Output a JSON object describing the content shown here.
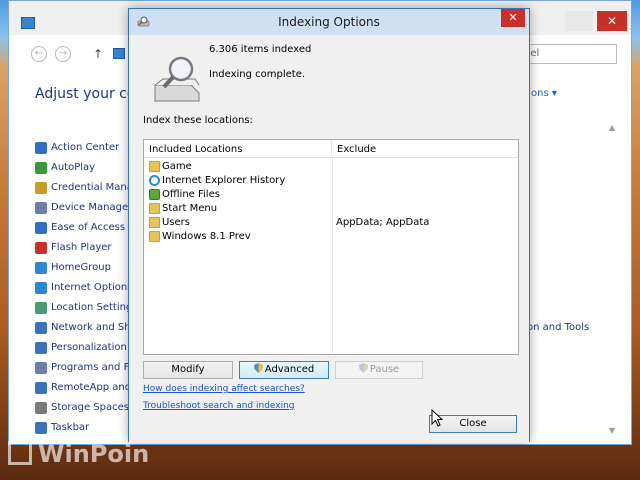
{
  "control_panel": {
    "search_placeholder": "nel",
    "heading": "Adjust your comp",
    "view_by": "ons ▾",
    "items": [
      {
        "label": "Action Center",
        "color": "#2f6fc4"
      },
      {
        "label": "AutoPlay",
        "color": "#3a9a3a"
      },
      {
        "label": "Credential Manag",
        "color": "#c79a2a"
      },
      {
        "label": "Device Manager",
        "color": "#6b7fa8"
      },
      {
        "label": "Ease of Access Ce",
        "color": "#2f6fc4"
      },
      {
        "label": "Flash Player",
        "color": "#c7312b"
      },
      {
        "label": "HomeGroup",
        "color": "#2f87d4"
      },
      {
        "label": "Internet Options",
        "color": "#2f87d4"
      },
      {
        "label": "Location Settings",
        "color": "#4a9a7a"
      },
      {
        "label": "Network and Shari",
        "color": "#3a73b8"
      },
      {
        "label": "Personalization",
        "color": "#3a73b8"
      },
      {
        "label": "Programs and Feat",
        "color": "#6b7fa8"
      },
      {
        "label": "RemoteApp and D",
        "color": "#3a73b8"
      },
      {
        "label": "Storage Spaces",
        "color": "#7a7a7a"
      },
      {
        "label": "Taskbar",
        "color": "#3a73b8"
      }
    ],
    "right_item": "on and Tools"
  },
  "dialog": {
    "title": "Indexing Options",
    "items_count": "6.306 items indexed",
    "status": "Indexing complete.",
    "caption": "Index these locations:",
    "columns": {
      "included": "Included Locations",
      "exclude": "Exclude"
    },
    "locations": [
      {
        "name": "Game",
        "exclude": "",
        "icon": "folder-icon"
      },
      {
        "name": "Internet Explorer History",
        "exclude": "",
        "icon": "internet-explorer-icon"
      },
      {
        "name": "Offline Files",
        "exclude": "",
        "icon": "offline-files-icon"
      },
      {
        "name": "Start Menu",
        "exclude": "",
        "icon": "folder-icon"
      },
      {
        "name": "Users",
        "exclude": "AppData; AppData",
        "icon": "folder-icon"
      },
      {
        "name": "Windows 8.1 Prev",
        "exclude": "",
        "icon": "folder-icon"
      }
    ],
    "buttons": {
      "modify": "Modify",
      "advanced": "Advanced",
      "pause": "Pause",
      "close": "Close"
    },
    "links": {
      "how": "How does indexing affect searches?",
      "troubleshoot": "Troubleshoot search and indexing"
    }
  },
  "watermark": "WinPoin"
}
